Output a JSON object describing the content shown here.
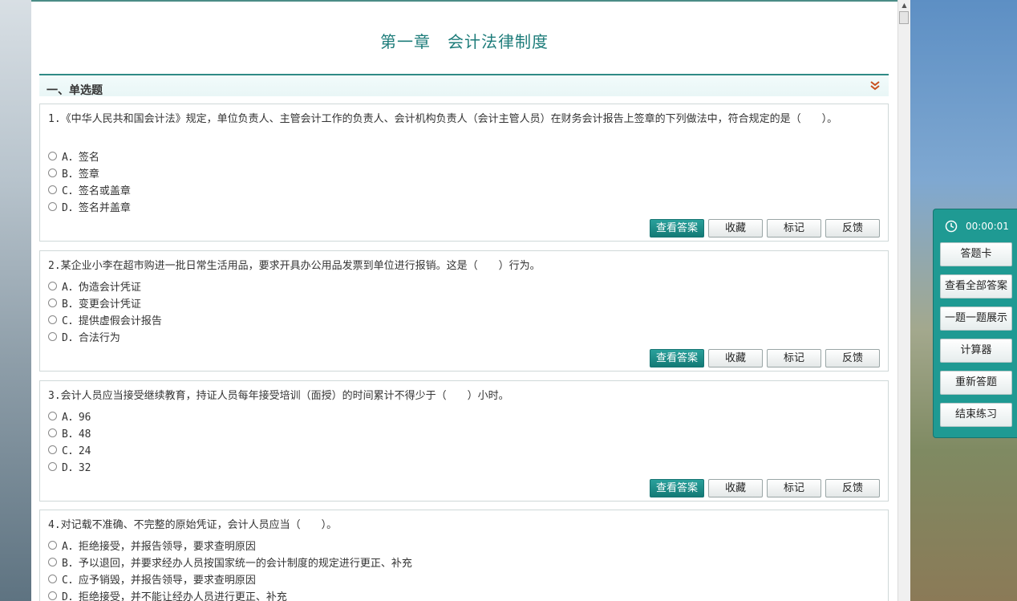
{
  "chapter_title": "第一章　会计法律制度",
  "section": {
    "title": "一、单选题"
  },
  "questions": [
    {
      "text": "1.《中华人民共和国会计法》规定，单位负责人、主管会计工作的负责人、会计机构负责人（会计主管人员）在财务会计报告上签章的下列做法中，符合规定的是（　　）。",
      "options": [
        "A．签名",
        "B．签章",
        "C．签名或盖章",
        "D．签名并盖章"
      ]
    },
    {
      "text": "2.某企业小李在超市购进一批日常生活用品，要求开具办公用品发票到单位进行报销。这是（　　）行为。",
      "options": [
        "A．伪造会计凭证",
        "B．变更会计凭证",
        "C．提供虚假会计报告",
        "D．合法行为"
      ]
    },
    {
      "text": "3.会计人员应当接受继续教育，持证人员每年接受培训（面授）的时间累计不得少于（　　）小时。",
      "options": [
        "A．96",
        "B．48",
        "C．24",
        "D．32"
      ]
    },
    {
      "text": "4.对记载不准确、不完整的原始凭证，会计人员应当（　　）。",
      "options": [
        "A．拒绝接受，并报告领导，要求查明原因",
        "B．予以退回，并要求经办人员按国家统一的会计制度的规定进行更正、补充",
        "C．应予销毁，并报告领导，要求查明原因",
        "D．拒绝接受，并不能让经办人员进行更正、补充"
      ]
    }
  ],
  "actions": {
    "view_answer": "查看答案",
    "favorite": "收藏",
    "mark": "标记",
    "feedback": "反馈"
  },
  "sidebar": {
    "timer": "00:00:01",
    "buttons": [
      "答题卡",
      "查看全部答案",
      "一题一题展示",
      "计算器",
      "重新答题",
      "结束练习"
    ]
  },
  "colors": {
    "accent": "#1f9a93",
    "title": "#1d7c7a"
  }
}
